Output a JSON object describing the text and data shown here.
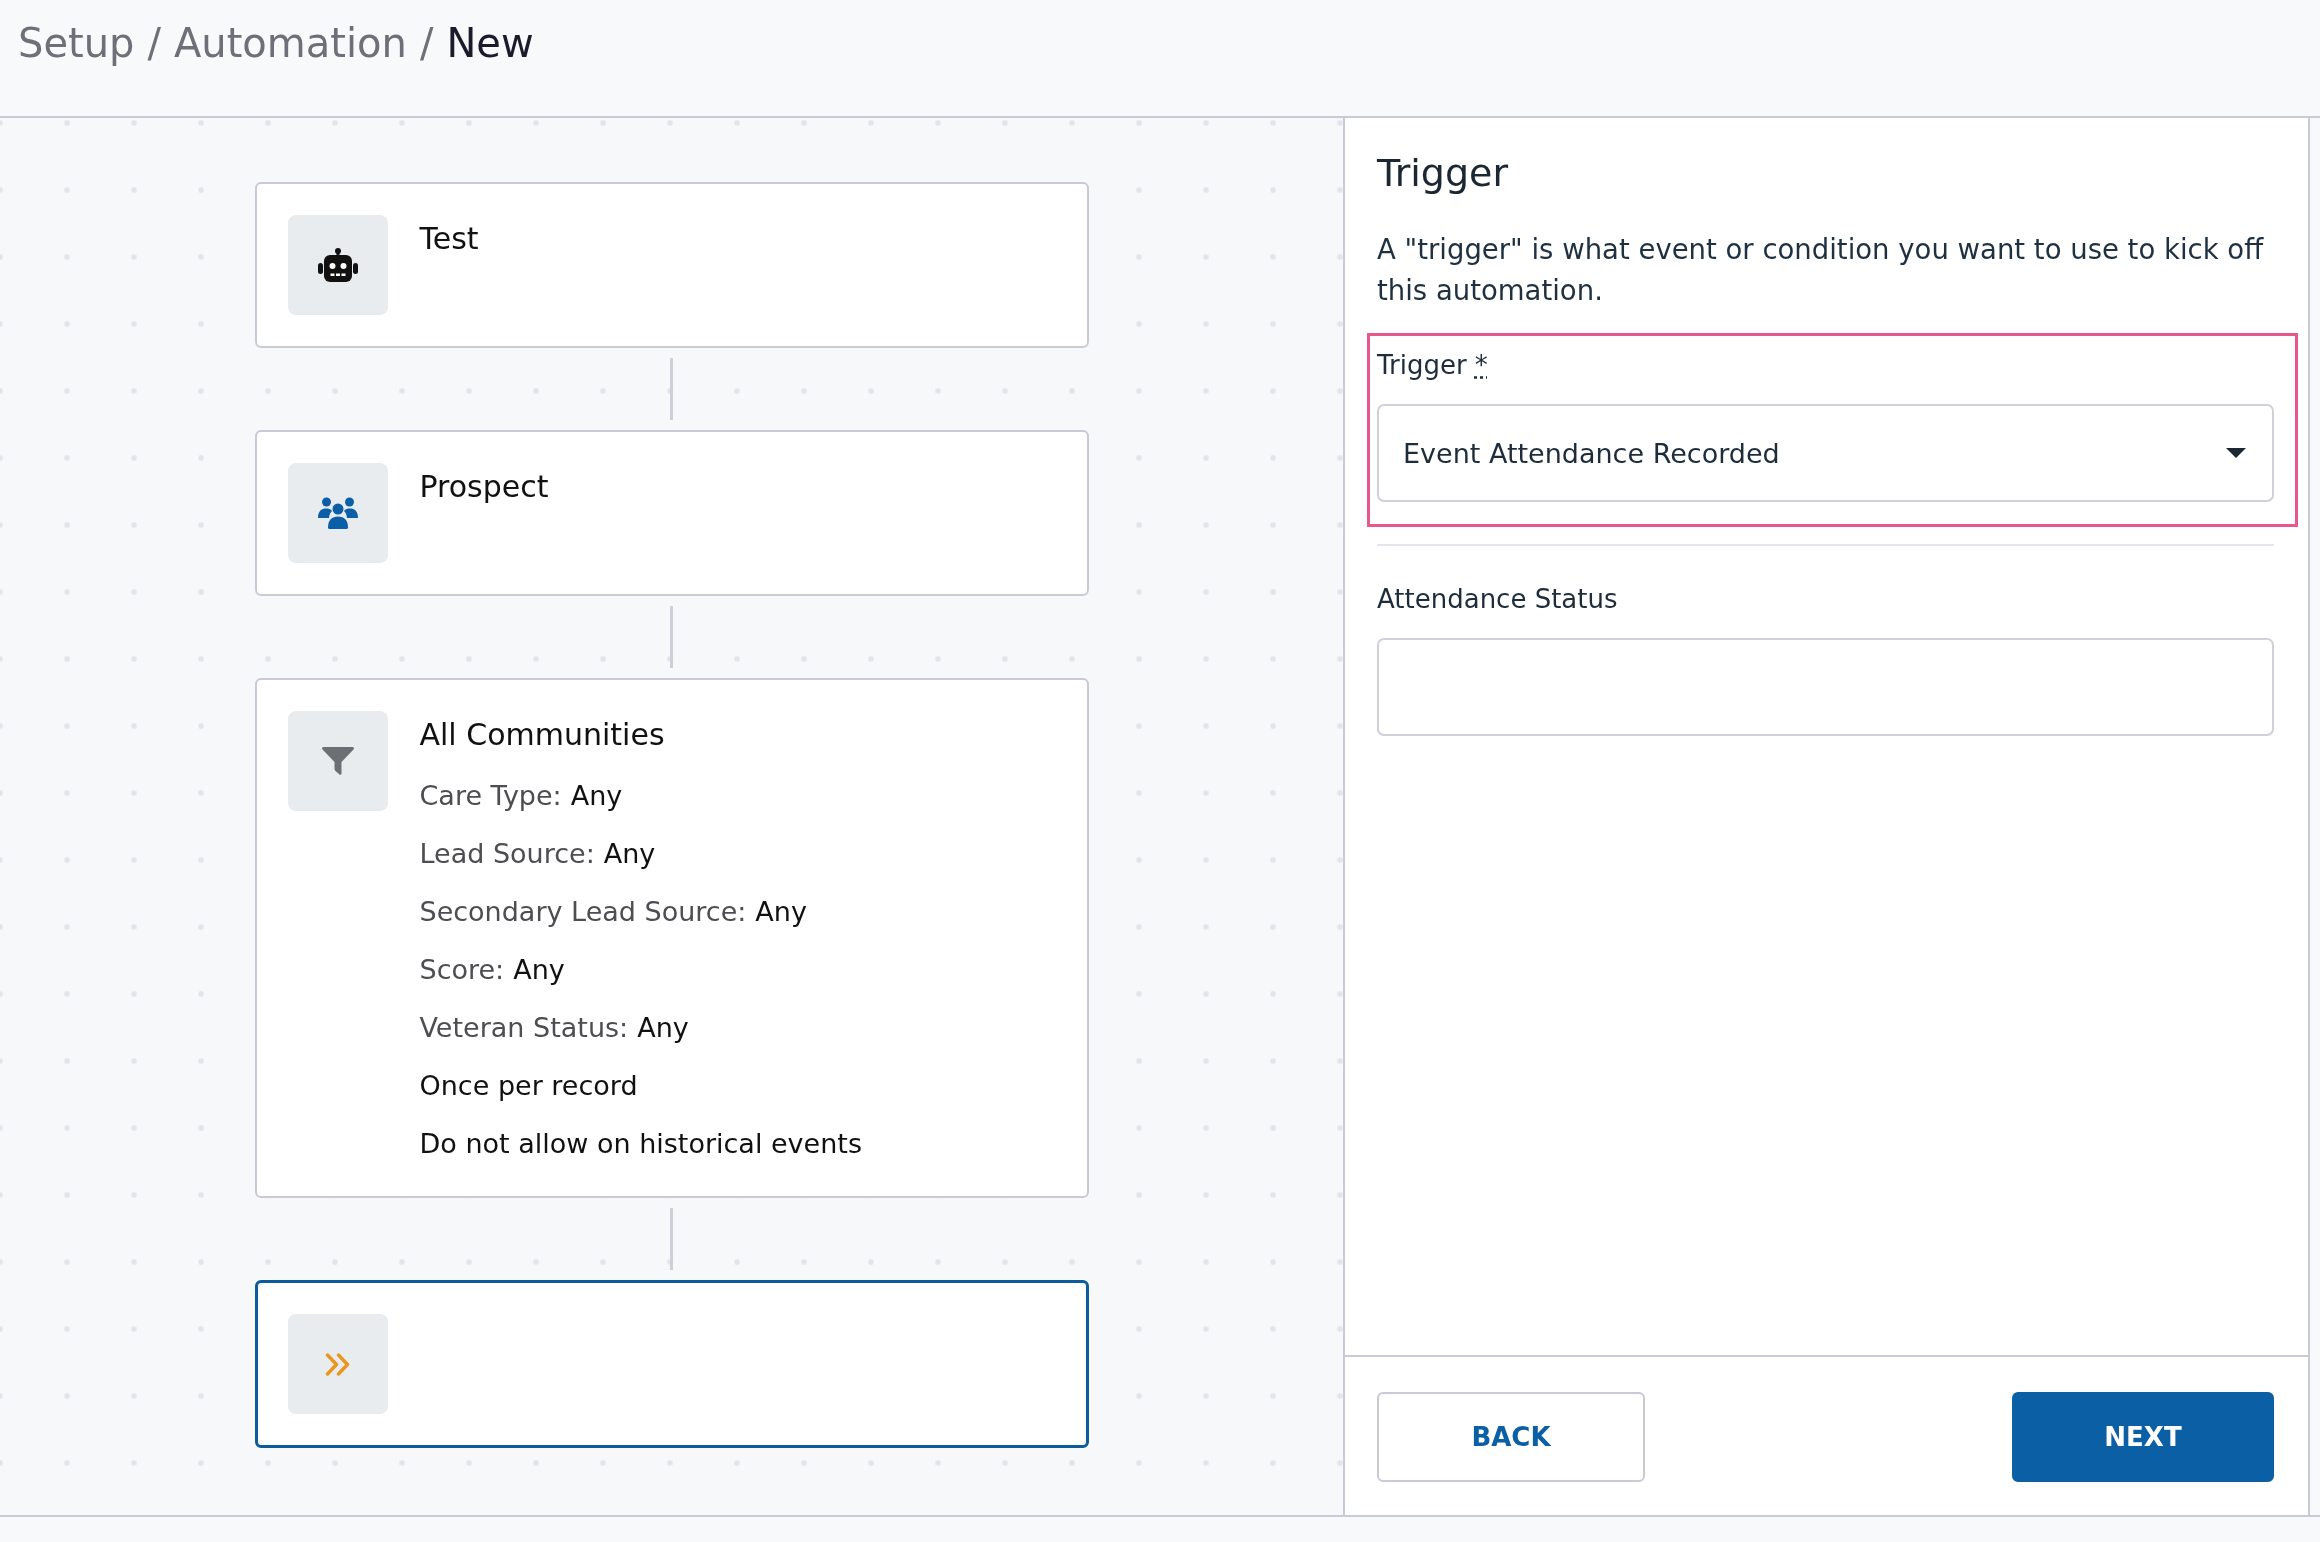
{
  "breadcrumb": [
    {
      "label": "Setup",
      "current": false,
      "separator": "/"
    },
    {
      "label": "Automation",
      "current": false,
      "separator": "/"
    },
    {
      "label": "New",
      "current": true
    }
  ],
  "flow": {
    "nodes": [
      {
        "kind": "automation",
        "title": "Test",
        "selected": false
      },
      {
        "kind": "audience",
        "title": "Prospect",
        "selected": false
      },
      {
        "kind": "filter",
        "title": "All Communities",
        "selected": false,
        "lines": [
          {
            "kind": "criterion",
            "label": "Care Type:",
            "value": "Any"
          },
          {
            "kind": "criterion",
            "label": "Lead Source:",
            "value": "Any"
          },
          {
            "kind": "criterion",
            "label": "Secondary Lead Source:",
            "value": "Any"
          },
          {
            "kind": "criterion",
            "label": "Score:",
            "value": "Any"
          },
          {
            "kind": "criterion",
            "label": "Veteran Status:",
            "value": "Any"
          },
          {
            "kind": "note",
            "text": "Once per record"
          },
          {
            "kind": "note",
            "text": "Do not allow on historical events"
          }
        ]
      },
      {
        "kind": "trigger",
        "selected": true
      }
    ]
  },
  "panel": {
    "title": "Trigger",
    "description": "A \"trigger\" is what event or condition you want to use to kick off this automation.",
    "fields": [
      {
        "kind": "select",
        "label": "Trigger",
        "required_mark": "*",
        "value": "Event Attendance Recorded",
        "highlighted": true
      },
      {
        "kind": "text",
        "label": "Attendance Status",
        "highlighted": false
      }
    ],
    "buttons": [
      {
        "kind": "secondary",
        "label": "BACK"
      },
      {
        "kind": "primary",
        "label": "NEXT"
      }
    ]
  }
}
